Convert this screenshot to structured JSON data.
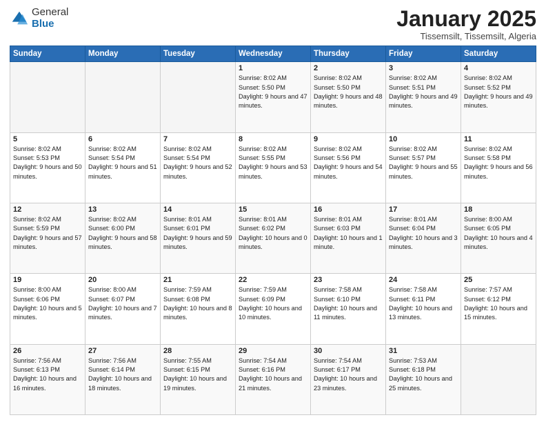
{
  "logo": {
    "general": "General",
    "blue": "Blue"
  },
  "header": {
    "month": "January 2025",
    "location": "Tissemsilt, Tissemsilt, Algeria"
  },
  "weekdays": [
    "Sunday",
    "Monday",
    "Tuesday",
    "Wednesday",
    "Thursday",
    "Friday",
    "Saturday"
  ],
  "weeks": [
    [
      {
        "day": "",
        "sunrise": "",
        "sunset": "",
        "daylight": ""
      },
      {
        "day": "",
        "sunrise": "",
        "sunset": "",
        "daylight": ""
      },
      {
        "day": "",
        "sunrise": "",
        "sunset": "",
        "daylight": ""
      },
      {
        "day": "1",
        "sunrise": "Sunrise: 8:02 AM",
        "sunset": "Sunset: 5:50 PM",
        "daylight": "Daylight: 9 hours and 47 minutes."
      },
      {
        "day": "2",
        "sunrise": "Sunrise: 8:02 AM",
        "sunset": "Sunset: 5:50 PM",
        "daylight": "Daylight: 9 hours and 48 minutes."
      },
      {
        "day": "3",
        "sunrise": "Sunrise: 8:02 AM",
        "sunset": "Sunset: 5:51 PM",
        "daylight": "Daylight: 9 hours and 49 minutes."
      },
      {
        "day": "4",
        "sunrise": "Sunrise: 8:02 AM",
        "sunset": "Sunset: 5:52 PM",
        "daylight": "Daylight: 9 hours and 49 minutes."
      }
    ],
    [
      {
        "day": "5",
        "sunrise": "Sunrise: 8:02 AM",
        "sunset": "Sunset: 5:53 PM",
        "daylight": "Daylight: 9 hours and 50 minutes."
      },
      {
        "day": "6",
        "sunrise": "Sunrise: 8:02 AM",
        "sunset": "Sunset: 5:54 PM",
        "daylight": "Daylight: 9 hours and 51 minutes."
      },
      {
        "day": "7",
        "sunrise": "Sunrise: 8:02 AM",
        "sunset": "Sunset: 5:54 PM",
        "daylight": "Daylight: 9 hours and 52 minutes."
      },
      {
        "day": "8",
        "sunrise": "Sunrise: 8:02 AM",
        "sunset": "Sunset: 5:55 PM",
        "daylight": "Daylight: 9 hours and 53 minutes."
      },
      {
        "day": "9",
        "sunrise": "Sunrise: 8:02 AM",
        "sunset": "Sunset: 5:56 PM",
        "daylight": "Daylight: 9 hours and 54 minutes."
      },
      {
        "day": "10",
        "sunrise": "Sunrise: 8:02 AM",
        "sunset": "Sunset: 5:57 PM",
        "daylight": "Daylight: 9 hours and 55 minutes."
      },
      {
        "day": "11",
        "sunrise": "Sunrise: 8:02 AM",
        "sunset": "Sunset: 5:58 PM",
        "daylight": "Daylight: 9 hours and 56 minutes."
      }
    ],
    [
      {
        "day": "12",
        "sunrise": "Sunrise: 8:02 AM",
        "sunset": "Sunset: 5:59 PM",
        "daylight": "Daylight: 9 hours and 57 minutes."
      },
      {
        "day": "13",
        "sunrise": "Sunrise: 8:02 AM",
        "sunset": "Sunset: 6:00 PM",
        "daylight": "Daylight: 9 hours and 58 minutes."
      },
      {
        "day": "14",
        "sunrise": "Sunrise: 8:01 AM",
        "sunset": "Sunset: 6:01 PM",
        "daylight": "Daylight: 9 hours and 59 minutes."
      },
      {
        "day": "15",
        "sunrise": "Sunrise: 8:01 AM",
        "sunset": "Sunset: 6:02 PM",
        "daylight": "Daylight: 10 hours and 0 minutes."
      },
      {
        "day": "16",
        "sunrise": "Sunrise: 8:01 AM",
        "sunset": "Sunset: 6:03 PM",
        "daylight": "Daylight: 10 hours and 1 minute."
      },
      {
        "day": "17",
        "sunrise": "Sunrise: 8:01 AM",
        "sunset": "Sunset: 6:04 PM",
        "daylight": "Daylight: 10 hours and 3 minutes."
      },
      {
        "day": "18",
        "sunrise": "Sunrise: 8:00 AM",
        "sunset": "Sunset: 6:05 PM",
        "daylight": "Daylight: 10 hours and 4 minutes."
      }
    ],
    [
      {
        "day": "19",
        "sunrise": "Sunrise: 8:00 AM",
        "sunset": "Sunset: 6:06 PM",
        "daylight": "Daylight: 10 hours and 5 minutes."
      },
      {
        "day": "20",
        "sunrise": "Sunrise: 8:00 AM",
        "sunset": "Sunset: 6:07 PM",
        "daylight": "Daylight: 10 hours and 7 minutes."
      },
      {
        "day": "21",
        "sunrise": "Sunrise: 7:59 AM",
        "sunset": "Sunset: 6:08 PM",
        "daylight": "Daylight: 10 hours and 8 minutes."
      },
      {
        "day": "22",
        "sunrise": "Sunrise: 7:59 AM",
        "sunset": "Sunset: 6:09 PM",
        "daylight": "Daylight: 10 hours and 10 minutes."
      },
      {
        "day": "23",
        "sunrise": "Sunrise: 7:58 AM",
        "sunset": "Sunset: 6:10 PM",
        "daylight": "Daylight: 10 hours and 11 minutes."
      },
      {
        "day": "24",
        "sunrise": "Sunrise: 7:58 AM",
        "sunset": "Sunset: 6:11 PM",
        "daylight": "Daylight: 10 hours and 13 minutes."
      },
      {
        "day": "25",
        "sunrise": "Sunrise: 7:57 AM",
        "sunset": "Sunset: 6:12 PM",
        "daylight": "Daylight: 10 hours and 15 minutes."
      }
    ],
    [
      {
        "day": "26",
        "sunrise": "Sunrise: 7:56 AM",
        "sunset": "Sunset: 6:13 PM",
        "daylight": "Daylight: 10 hours and 16 minutes."
      },
      {
        "day": "27",
        "sunrise": "Sunrise: 7:56 AM",
        "sunset": "Sunset: 6:14 PM",
        "daylight": "Daylight: 10 hours and 18 minutes."
      },
      {
        "day": "28",
        "sunrise": "Sunrise: 7:55 AM",
        "sunset": "Sunset: 6:15 PM",
        "daylight": "Daylight: 10 hours and 19 minutes."
      },
      {
        "day": "29",
        "sunrise": "Sunrise: 7:54 AM",
        "sunset": "Sunset: 6:16 PM",
        "daylight": "Daylight: 10 hours and 21 minutes."
      },
      {
        "day": "30",
        "sunrise": "Sunrise: 7:54 AM",
        "sunset": "Sunset: 6:17 PM",
        "daylight": "Daylight: 10 hours and 23 minutes."
      },
      {
        "day": "31",
        "sunrise": "Sunrise: 7:53 AM",
        "sunset": "Sunset: 6:18 PM",
        "daylight": "Daylight: 10 hours and 25 minutes."
      },
      {
        "day": "",
        "sunrise": "",
        "sunset": "",
        "daylight": ""
      }
    ]
  ]
}
